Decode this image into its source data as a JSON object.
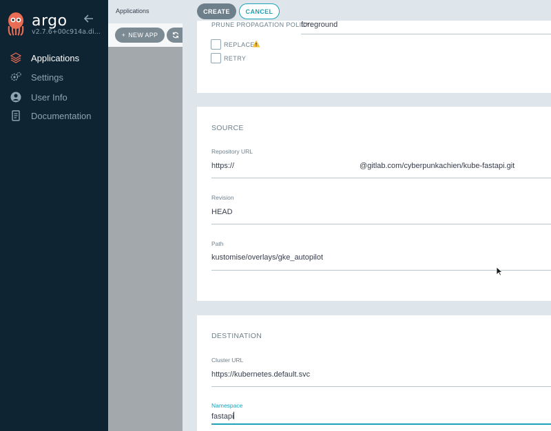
{
  "sidebar": {
    "brand": "argo",
    "version": "v2.7.6+00c914a.di...",
    "items": [
      {
        "label": "Applications",
        "icon": "layers-icon",
        "active": true
      },
      {
        "label": "Settings",
        "icon": "gear-icon",
        "active": false
      },
      {
        "label": "User Info",
        "icon": "user-icon",
        "active": false
      },
      {
        "label": "Documentation",
        "icon": "book-icon",
        "active": false
      }
    ]
  },
  "page": {
    "title": "Applications",
    "new_app_label": "NEW APP"
  },
  "panel": {
    "create_label": "CREATE",
    "cancel_label": "CANCEL",
    "sync_policy": {
      "prune_label": "PRUNE PROPAGATION POLICY:",
      "prune_value": "foreground",
      "replace_label": "REPLACE",
      "retry_label": "RETRY"
    },
    "source": {
      "title": "SOURCE",
      "repo_label": "Repository URL",
      "repo_prefix": "https://",
      "repo_suffix": "@gitlab.com/cyberpunkachien/kube-fastapi.git",
      "revision_label": "Revision",
      "revision_value": "HEAD",
      "path_label": "Path",
      "path_value": "kustomise/overlays/gke_autopilot"
    },
    "destination": {
      "title": "DESTINATION",
      "cluster_label": "Cluster URL",
      "cluster_value": "https://kubernetes.default.svc",
      "namespace_label": "Namespace",
      "namespace_value": "fastapi"
    }
  },
  "colors": {
    "sidebar_bg": "#0e2432",
    "accent": "#19a2b8",
    "warning": "#f4c030"
  }
}
